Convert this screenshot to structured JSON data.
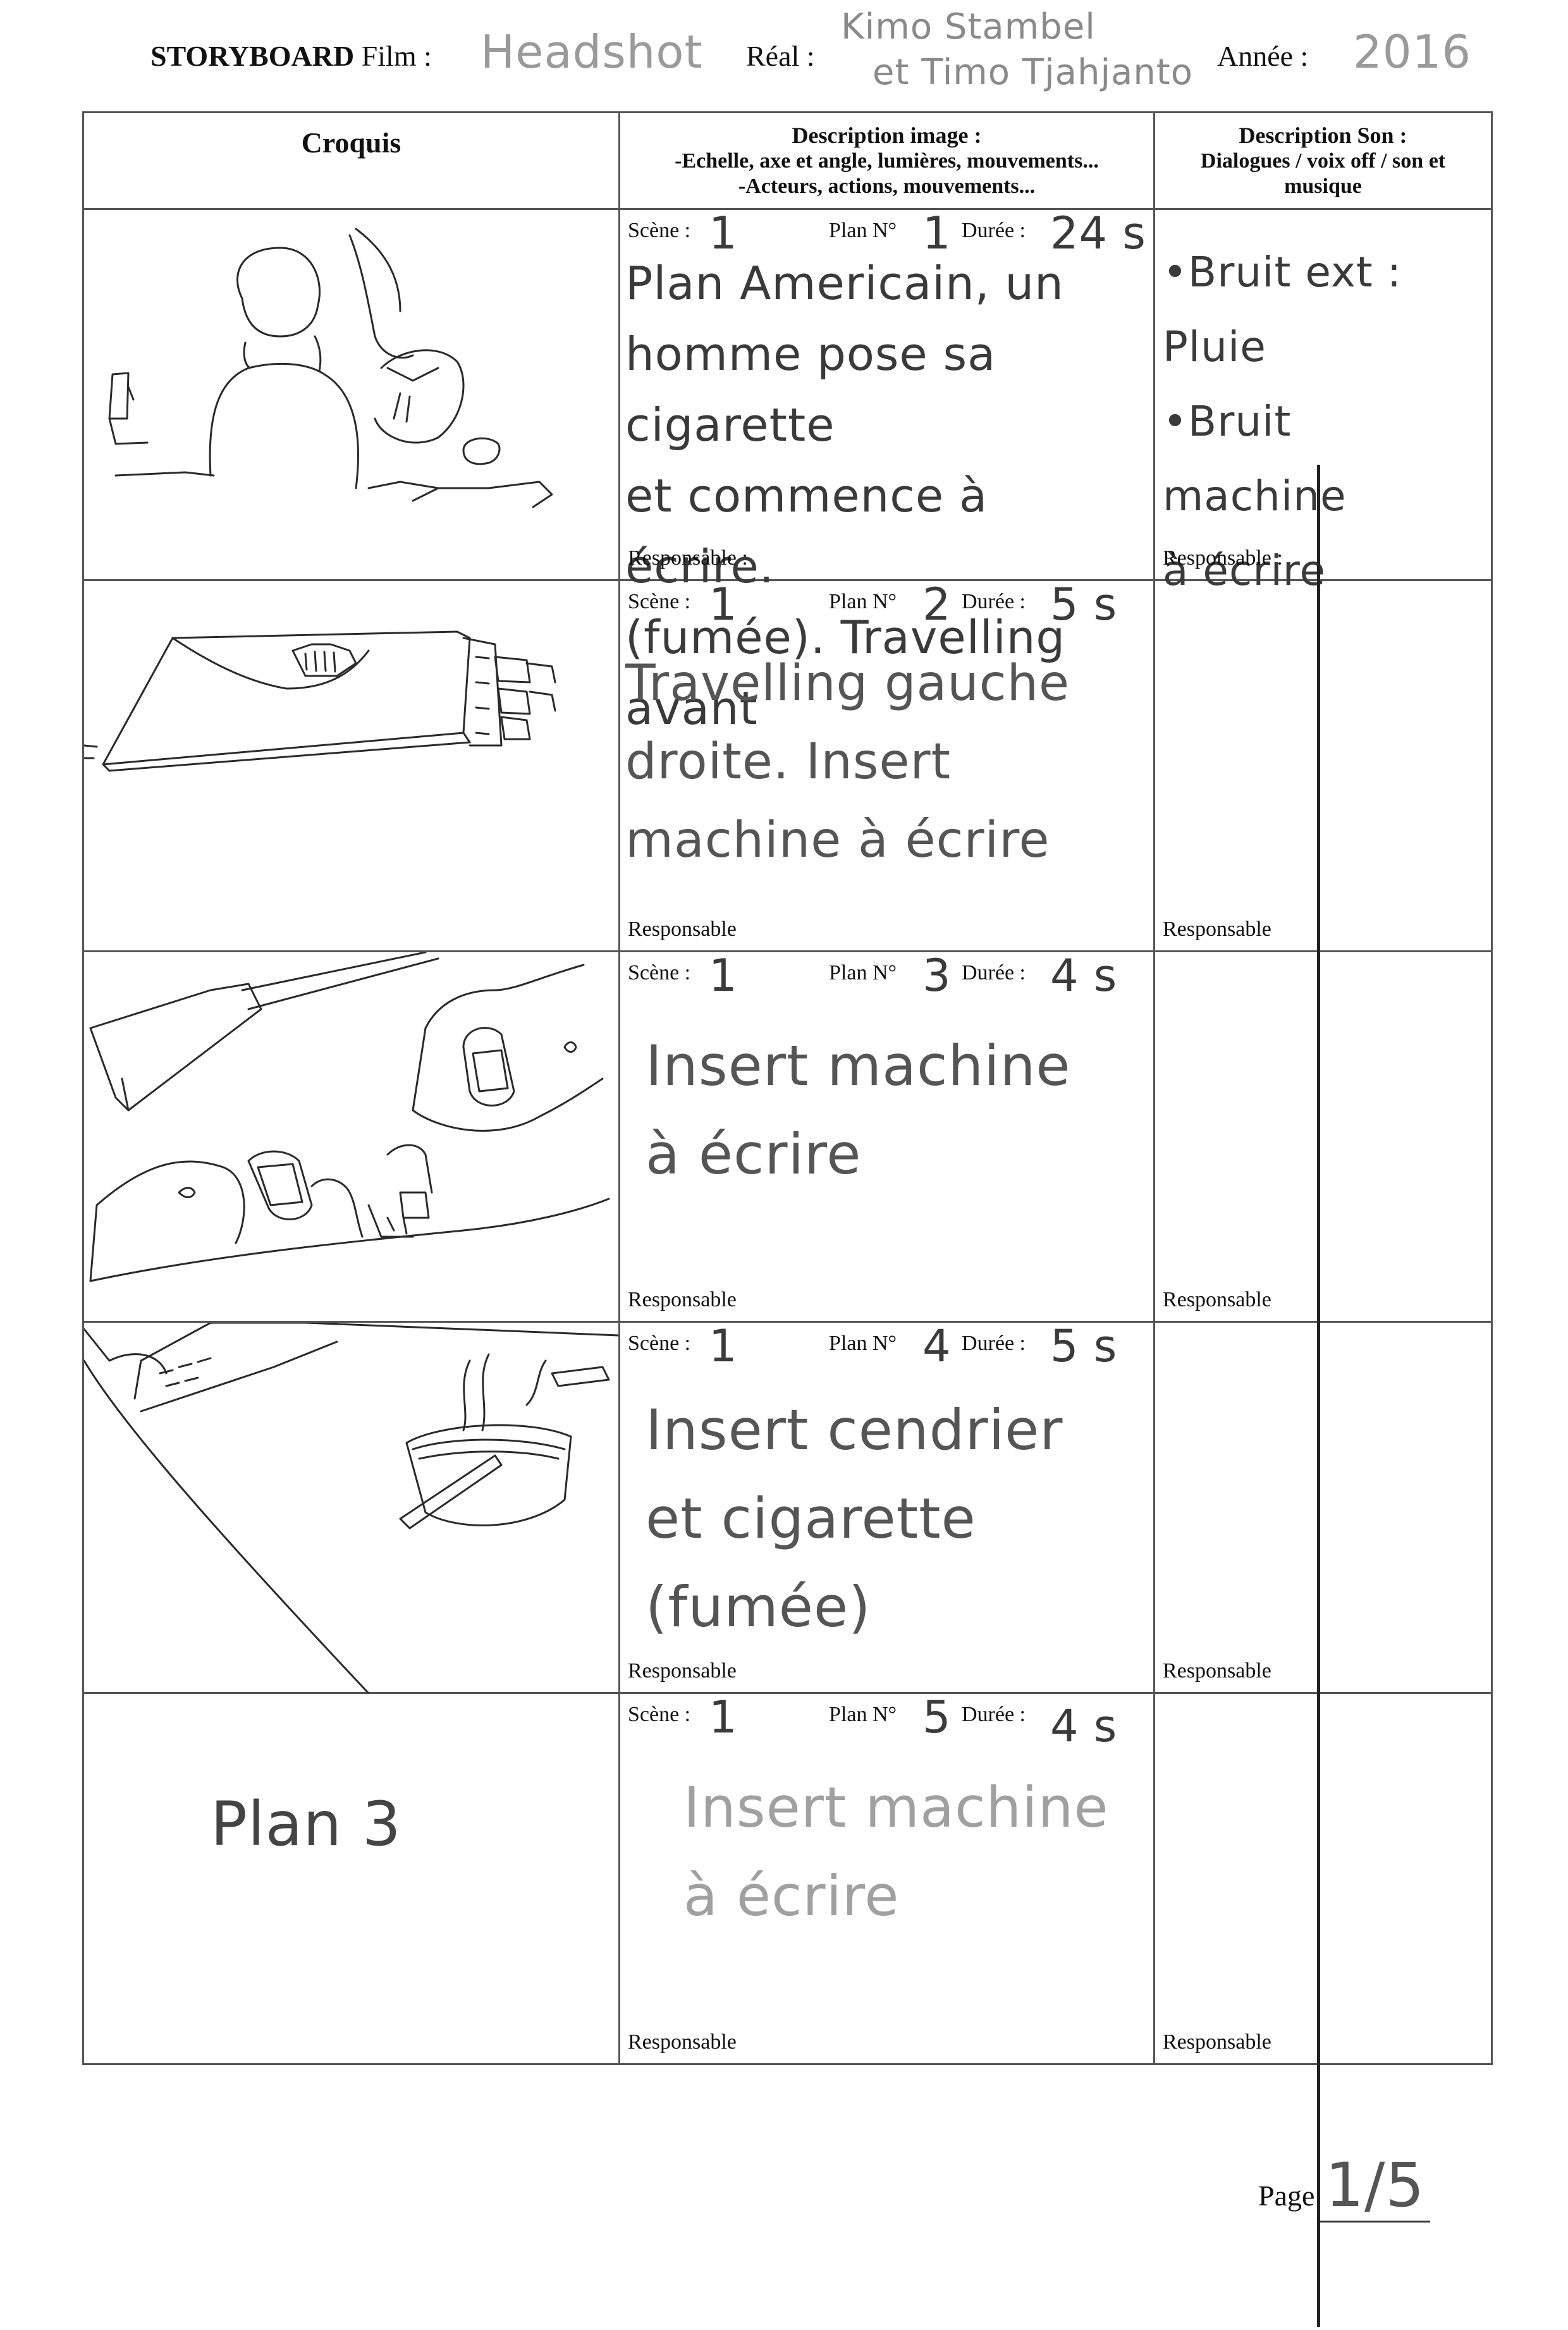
{
  "header": {
    "storyboard_label": "STORYBOARD",
    "film_label": "Film  :",
    "film_value": "Headshot",
    "real_label": "Réal  :",
    "real_value_line1": "Kimo Stambel",
    "real_value_line2": "et Timo Tjahjanto",
    "year_label": "Année  :",
    "year_value": "2016"
  },
  "columns": {
    "sketch_title": "Croquis",
    "desc_title": "Description image  :",
    "desc_sub1": "-Echelle, axe et angle, lumières, mouvements...",
    "desc_sub2": "-Acteurs, actions, mouvements...",
    "sound_title": "Description Son  :",
    "sound_sub1": "Dialogues / voix off / son et",
    "sound_sub2": "musique"
  },
  "labels": {
    "scene": "Scène  :",
    "plan": "Plan N°",
    "duree": "Durée :",
    "responsable_colon": "Responsable :",
    "responsable": "Responsable"
  },
  "rows": [
    {
      "scene": "1",
      "plan": "1",
      "duree": "24 s",
      "description": "Plan Americain, un\nhomme pose sa cigarette\net commence à écrire.\n(fumée). Travelling\navant",
      "sound": "•Bruit ext : Pluie\n•Bruit machine\nà écrire",
      "sketch_text": ""
    },
    {
      "scene": "1",
      "plan": "2",
      "duree": "5 s",
      "description": "Travelling gauche\ndroite. Insert\nmachine à écrire",
      "sound": "",
      "sketch_text": ""
    },
    {
      "scene": "1",
      "plan": "3",
      "duree": "4 s",
      "description": "Insert machine\nà écrire",
      "sound": "",
      "sketch_text": ""
    },
    {
      "scene": "1",
      "plan": "4",
      "duree": "5 s",
      "description": "Insert cendrier\net cigarette\n(fumée)",
      "sound": "",
      "sketch_text": ""
    },
    {
      "scene": "1",
      "plan": "5",
      "duree": "4 s",
      "description": "Insert machine\nà écrire",
      "sound": "",
      "sketch_text": "Plan 3"
    }
  ],
  "footer": {
    "page_label": "Page",
    "page_value": "1/5"
  }
}
